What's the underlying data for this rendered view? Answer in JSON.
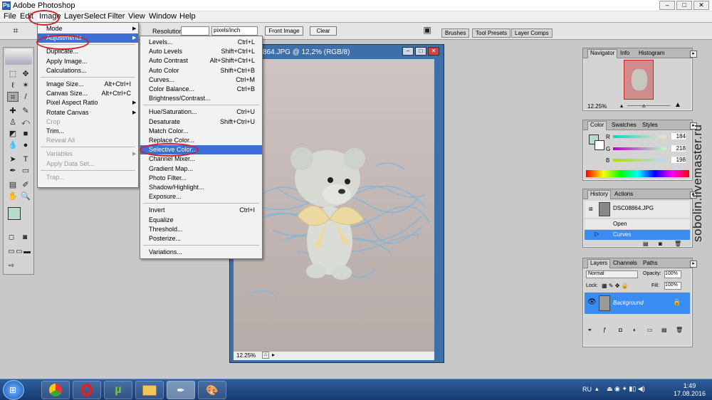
{
  "app": {
    "title": "Adobe Photoshop"
  },
  "menubar": [
    "File",
    "Edit",
    "Image",
    "Layer",
    "Select",
    "Filter",
    "View",
    "Window",
    "Help"
  ],
  "options": {
    "resolution_label": "Resolution:",
    "resolution_value": "",
    "units": "pixels/inch",
    "front_image": "Front Image",
    "clear": "Clear"
  },
  "wells": [
    "Brushes",
    "Tool Presets",
    "Layer Comps"
  ],
  "image_menu": [
    {
      "label": "Mode",
      "arrow": true
    },
    {
      "label": "Adjustments",
      "arrow": true,
      "highlight": true
    },
    {
      "sep": true
    },
    {
      "label": "Duplicate..."
    },
    {
      "label": "Apply Image..."
    },
    {
      "label": "Calculations..."
    },
    {
      "sep": true
    },
    {
      "label": "Image Size...",
      "shortcut": "Alt+Ctrl+I"
    },
    {
      "label": "Canvas Size...",
      "shortcut": "Alt+Ctrl+C"
    },
    {
      "label": "Pixel Aspect Ratio",
      "arrow": true
    },
    {
      "label": "Rotate Canvas",
      "arrow": true
    },
    {
      "label": "Crop",
      "disabled": true
    },
    {
      "label": "Trim..."
    },
    {
      "label": "Reveal All",
      "disabled": true
    },
    {
      "sep": true
    },
    {
      "label": "Variables",
      "arrow": true,
      "disabled": true
    },
    {
      "label": "Apply Data Set...",
      "disabled": true
    },
    {
      "sep": true
    },
    {
      "label": "Trap...",
      "disabled": true
    }
  ],
  "adjust_menu": [
    {
      "label": "Levels...",
      "shortcut": "Ctrl+L"
    },
    {
      "label": "Auto Levels",
      "shortcut": "Shift+Ctrl+L"
    },
    {
      "label": "Auto Contrast",
      "shortcut": "Alt+Shift+Ctrl+L"
    },
    {
      "label": "Auto Color",
      "shortcut": "Shift+Ctrl+B"
    },
    {
      "label": "Curves...",
      "shortcut": "Ctrl+M"
    },
    {
      "label": "Color Balance...",
      "shortcut": "Ctrl+B"
    },
    {
      "label": "Brightness/Contrast..."
    },
    {
      "sep": true
    },
    {
      "label": "Hue/Saturation...",
      "shortcut": "Ctrl+U"
    },
    {
      "label": "Desaturate",
      "shortcut": "Shift+Ctrl+U"
    },
    {
      "label": "Match Color..."
    },
    {
      "label": "Replace Color..."
    },
    {
      "label": "Selective Color...",
      "highlight": true
    },
    {
      "label": "Channel Mixer..."
    },
    {
      "label": "Gradient Map..."
    },
    {
      "label": "Photo Filter..."
    },
    {
      "label": "Shadow/Highlight..."
    },
    {
      "label": "Exposure..."
    },
    {
      "sep": true
    },
    {
      "label": "Invert",
      "shortcut": "Ctrl+I"
    },
    {
      "label": "Equalize"
    },
    {
      "label": "Threshold..."
    },
    {
      "label": "Posterize..."
    },
    {
      "sep": true
    },
    {
      "label": "Variations..."
    }
  ],
  "document": {
    "title": "864.JPG @ 12,2% (RGB/8)",
    "zoom": "12.25%"
  },
  "navigator": {
    "tabs": [
      "Navigator",
      "Info",
      "Histogram"
    ],
    "zoom": "12.25%"
  },
  "color": {
    "tabs": [
      "Color",
      "Swatches",
      "Styles"
    ],
    "r_label": "R",
    "g_label": "G",
    "b_label": "B",
    "r": "184",
    "g": "218",
    "b": "198",
    "fg": "#b8dac6"
  },
  "history": {
    "tabs": [
      "History",
      "Actions"
    ],
    "snapshot": "DSC08864.JPG",
    "items": [
      "Open",
      "Curves"
    ]
  },
  "layers": {
    "tabs": [
      "Layers",
      "Channels",
      "Paths"
    ],
    "blend": "Normal",
    "opacity_label": "Opacity:",
    "opacity": "100%",
    "lock_label": "Lock:",
    "fill_label": "Fill:",
    "fill": "100%",
    "layer_name": "Background"
  },
  "taskbar": {
    "lang": "RU",
    "time": "1:49",
    "date": "17.08.2016"
  },
  "watermark": "sobolin.livemaster.ru"
}
